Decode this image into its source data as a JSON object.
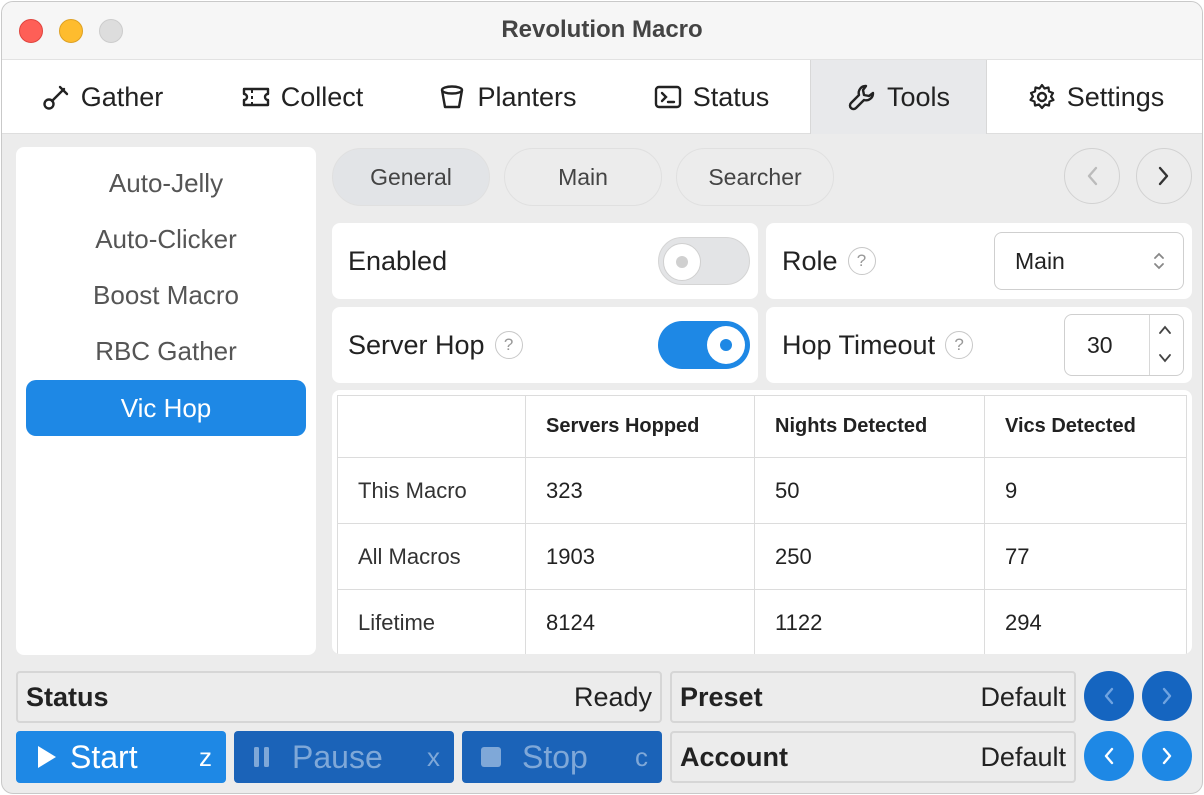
{
  "window": {
    "title": "Revolution Macro"
  },
  "tabs": [
    {
      "label": "Gather",
      "icon": "shovel-icon"
    },
    {
      "label": "Collect",
      "icon": "ticket-icon"
    },
    {
      "label": "Planters",
      "icon": "pot-icon"
    },
    {
      "label": "Status",
      "icon": "terminal-icon"
    },
    {
      "label": "Tools",
      "icon": "wrench-icon",
      "active": true
    },
    {
      "label": "Settings",
      "icon": "gear-icon"
    }
  ],
  "sidebar": {
    "items": [
      {
        "label": "Auto-Jelly"
      },
      {
        "label": "Auto-Clicker"
      },
      {
        "label": "Boost Macro"
      },
      {
        "label": "RBC Gather"
      },
      {
        "label": "Vic Hop",
        "active": true
      }
    ]
  },
  "subtabs": [
    {
      "label": "General",
      "active": true
    },
    {
      "label": "Main"
    },
    {
      "label": "Searcher"
    }
  ],
  "settings": {
    "enabled_label": "Enabled",
    "enabled_value": false,
    "role_label": "Role",
    "role_value": "Main",
    "server_hop_label": "Server Hop",
    "server_hop_value": true,
    "hop_timeout_label": "Hop Timeout",
    "hop_timeout_value": "30",
    "help_symbol": "?"
  },
  "stats": {
    "columns": [
      "",
      "Servers Hopped",
      "Nights Detected",
      "Vics Detected"
    ],
    "rows": [
      {
        "label": "This Macro",
        "values": [
          "323",
          "50",
          "9"
        ]
      },
      {
        "label": "All Macros",
        "values": [
          "1903",
          "250",
          "77"
        ]
      },
      {
        "label": "Lifetime",
        "values": [
          "8124",
          "1122",
          "294"
        ]
      }
    ]
  },
  "footer": {
    "status_label": "Status",
    "status_value": "Ready",
    "preset_label": "Preset",
    "preset_value": "Default",
    "account_label": "Account",
    "account_value": "Default",
    "start_label": "Start",
    "start_key": "z",
    "pause_label": "Pause",
    "pause_key": "x",
    "stop_label": "Stop",
    "stop_key": "c"
  },
  "colors": {
    "accent": "#1e88e5",
    "accent_dark": "#1b63b8"
  }
}
